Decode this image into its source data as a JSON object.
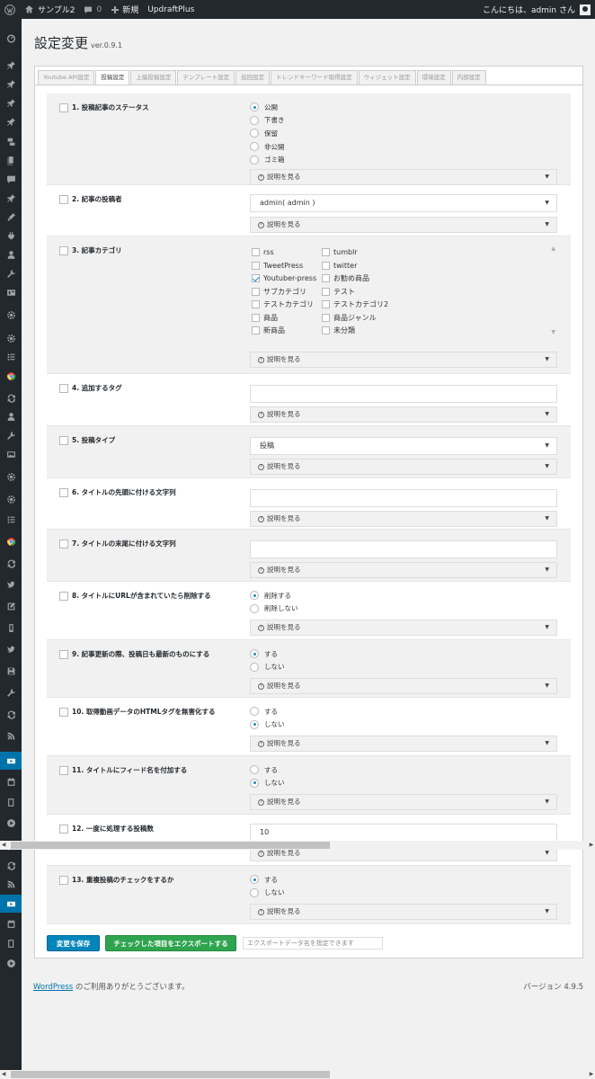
{
  "adminbar": {
    "site_name": "サンプル2",
    "comments_count": "0",
    "new_label": "新規",
    "plugin_label": "UpdraftPlus",
    "greeting": "こんにちは、admin さん"
  },
  "page": {
    "title": "設定変更",
    "version": "ver.0.9.1"
  },
  "tabs": [
    "Youtube API設定",
    "投稿設定",
    "上級投稿設定",
    "テンプレート設定",
    "巡回設定",
    "トレンドキーワード取得設定",
    "ウィジェット設定",
    "環境設定",
    "内部設定"
  ],
  "active_tab": "投稿設定",
  "help_label": "説明を見る",
  "rows": {
    "r1": {
      "label": "1. 投稿記事のステータス",
      "options": [
        "公開",
        "下書き",
        "保留",
        "非公開",
        "ゴミ箱"
      ],
      "selected": "公開"
    },
    "r2": {
      "label": "2. 記事の投稿者",
      "value": "admin( admin )"
    },
    "r3": {
      "label": "3. 記事カテゴリ",
      "categories": [
        "rss",
        "tumblr",
        "TweetPress",
        "twitter",
        "Youtuber-press",
        "お勧め商品",
        "サブカテゴリ",
        "テスト",
        "テストカテゴリ",
        "テストカテゴリ2",
        "商品",
        "商品ジャンル",
        "新商品",
        "未分類"
      ],
      "checked": "Youtuber-press"
    },
    "r4": {
      "label": "4. 追加するタグ",
      "value": ""
    },
    "r5": {
      "label": "5. 投稿タイプ",
      "value": "投稿"
    },
    "r6": {
      "label": "6. タイトルの先頭に付ける文字列",
      "value": ""
    },
    "r7": {
      "label": "7. タイトルの末尾に付ける文字列",
      "value": ""
    },
    "r8": {
      "label": "8. タイトルにURLが含まれていたら削除する",
      "options": [
        "削除する",
        "削除しない"
      ],
      "selected": "削除する"
    },
    "r9": {
      "label": "9. 記事更新の際、投稿日も最新のものにする",
      "options": [
        "する",
        "しない"
      ],
      "selected": "する"
    },
    "r10": {
      "label": "10. 取得動画データのHTMLタグを無害化する",
      "options": [
        "する",
        "しない"
      ],
      "selected": "しない"
    },
    "r11": {
      "label": "11. タイトルにフィード名を付加する",
      "options": [
        "する",
        "しない"
      ],
      "selected": "しない"
    },
    "r12": {
      "label": "12. 一度に処理する投稿数",
      "value": "10"
    },
    "r13": {
      "label": "13. 重複投稿のチェックをするか",
      "options": [
        "する",
        "しない"
      ],
      "selected": "する"
    }
  },
  "actions": {
    "save_label": "変更を保存",
    "export_label": "チェックした項目をエクスポートする",
    "export_placeholder": "エクスポートデータ名を指定できます"
  },
  "footer": {
    "wp_link": "WordPress",
    "thanks": " のご利用ありがとうございます。",
    "version": "バージョン 4.9.5"
  },
  "colors": {
    "accent": "#0073aa",
    "save_button": "#0085ba",
    "export_button": "#2ea44f",
    "adminbar_bg": "#23282d"
  },
  "sidebar_icons": [
    "dashboard-icon",
    "pin-icon",
    "pin-icon",
    "pin-icon",
    "pin-icon",
    "media-icon",
    "pages-icon",
    "comments-icon",
    "pin-icon",
    "appearance-icon",
    "plugins-icon",
    "users-icon",
    "tools-icon",
    "settings-icon",
    "gear-icon",
    "gear-icon",
    "list-icon",
    "chrome-icon",
    "sync-icon",
    "users-icon",
    "wrench-icon",
    "image-icon",
    "gear-icon",
    "gear-icon",
    "list-icon",
    "chrome-icon",
    "sync-icon",
    "twitter-icon",
    "edit-icon",
    "tablet-icon",
    "twitter-icon",
    "save-icon",
    "wrench-icon",
    "sync-icon",
    "rss-icon",
    "youtube-icon",
    "calendar-icon",
    "book-icon",
    "play-icon",
    "wrench-icon",
    "sync-icon",
    "rss-icon",
    "youtube-icon",
    "calendar-icon",
    "book-icon",
    "play-icon"
  ]
}
